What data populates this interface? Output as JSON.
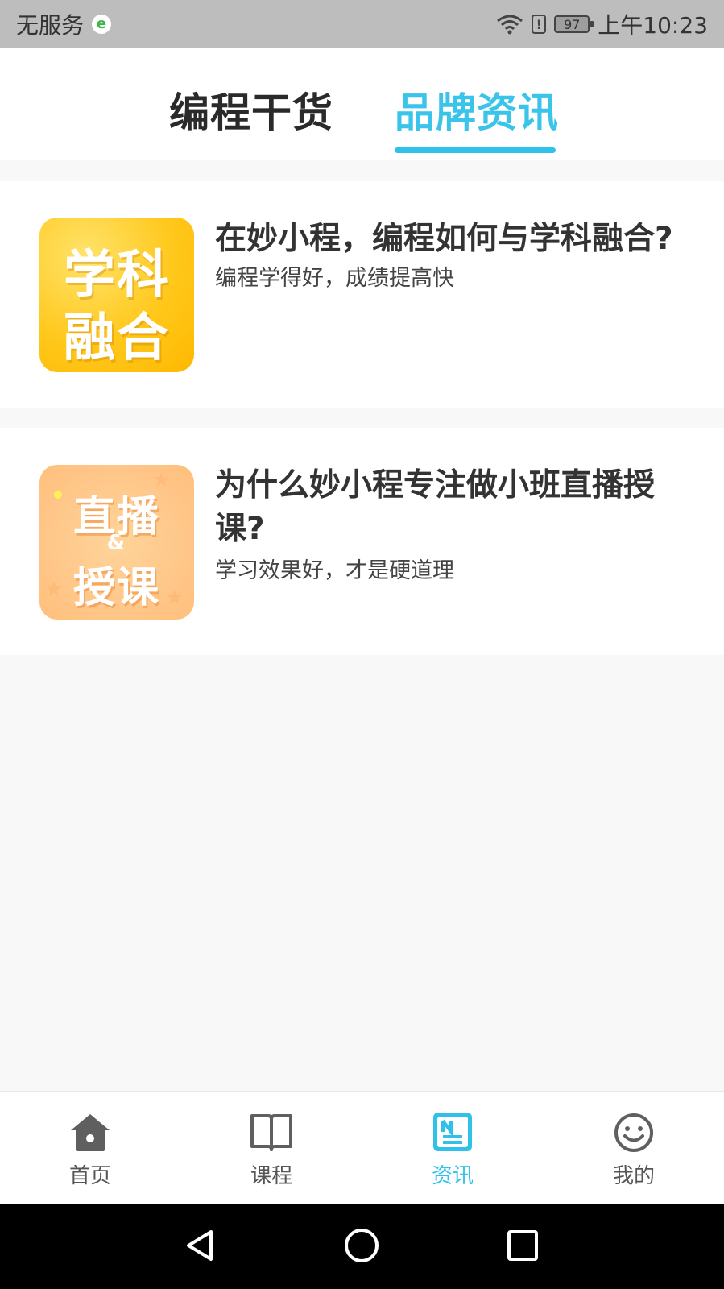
{
  "status_bar": {
    "carrier": "无服务",
    "e_badge": "e",
    "alert": "!",
    "battery": "97",
    "time": "上午10:23"
  },
  "tabs": [
    {
      "label": "编程干货",
      "active": false
    },
    {
      "label": "品牌资讯",
      "active": true
    }
  ],
  "articles": [
    {
      "thumb_line1": "学科",
      "thumb_line2": "融合",
      "title": "在妙小程，编程如何与学科融合?",
      "desc": "编程学得好，成绩提高快"
    },
    {
      "thumb_line1": "直播",
      "thumb_amp": "&",
      "thumb_line2": "授课",
      "title": "为什么妙小程专注做小班直播授课?",
      "desc": "学习效果好，才是硬道理"
    }
  ],
  "bottom_nav": [
    {
      "label": "首页",
      "icon": "home-icon"
    },
    {
      "label": "课程",
      "icon": "book-icon"
    },
    {
      "label": "资讯",
      "icon": "news-icon",
      "active": true
    },
    {
      "label": "我的",
      "icon": "smiley-icon"
    }
  ],
  "colors": {
    "accent": "#2fc1ea",
    "thumb1": "#ffc81c",
    "thumb2": "#ffc78a"
  }
}
